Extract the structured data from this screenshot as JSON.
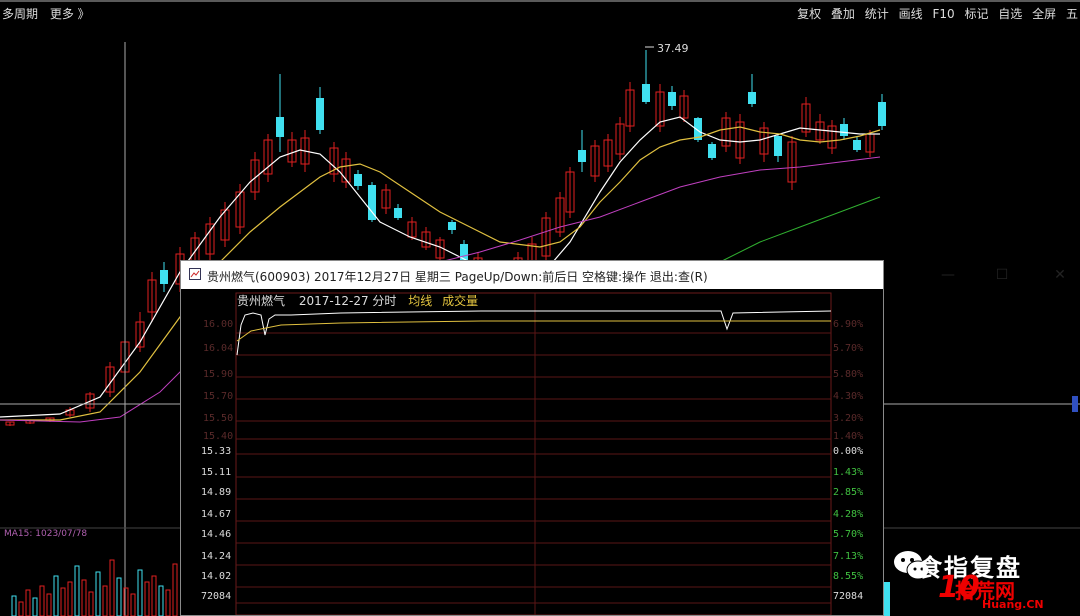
{
  "topbar": {
    "left_items": [
      "多周期",
      "更多 》"
    ],
    "right_items": [
      "复权",
      "叠加",
      "统计",
      "画线",
      "F10",
      "标记",
      "自选",
      "全屏",
      "五"
    ]
  },
  "main_chart": {
    "max_label": "37.49",
    "indicator_label": "MA15: 1023/07/78",
    "colors": {
      "up": "#e02020",
      "down": "#40e0f0",
      "ma5": "#ffffff",
      "ma10": "#e0c040",
      "ma20": "#c040c0",
      "ma60": "#30b030"
    }
  },
  "popup": {
    "title": "贵州燃气(600903) 2017年12月27日 星期三 PageUp/Down:前后日 空格键:操作 退出:查(R)",
    "minimize_glyph": "—",
    "maximize_glyph": "☐",
    "close_glyph": "✕",
    "header": {
      "name": "贵州燃气",
      "date": "2017-12-27 分时",
      "avg_label": "均线",
      "vol_label": "成交量"
    },
    "left_prices": [
      "15.33",
      "15.11",
      "14.89",
      "14.67",
      "14.46",
      "14.24",
      "14.02",
      "72084"
    ],
    "right_pcts": [
      "0.00%",
      "1.43%",
      "2.85%",
      "4.28%",
      "5.70%",
      "7.13%",
      "8.55%",
      "72084"
    ],
    "dim_left": [
      "16.00",
      "16.04",
      "15.90",
      "15.70",
      "15.50",
      "15.40"
    ],
    "dim_right": [
      "6.90%",
      "5.70%",
      "5.80%",
      "4.30%",
      "3.20%",
      "1.40%"
    ]
  },
  "watermark": {
    "text": "食指复盘",
    "logo_number": "10",
    "site": "拾荒网",
    "url": "Huang.CN"
  }
}
